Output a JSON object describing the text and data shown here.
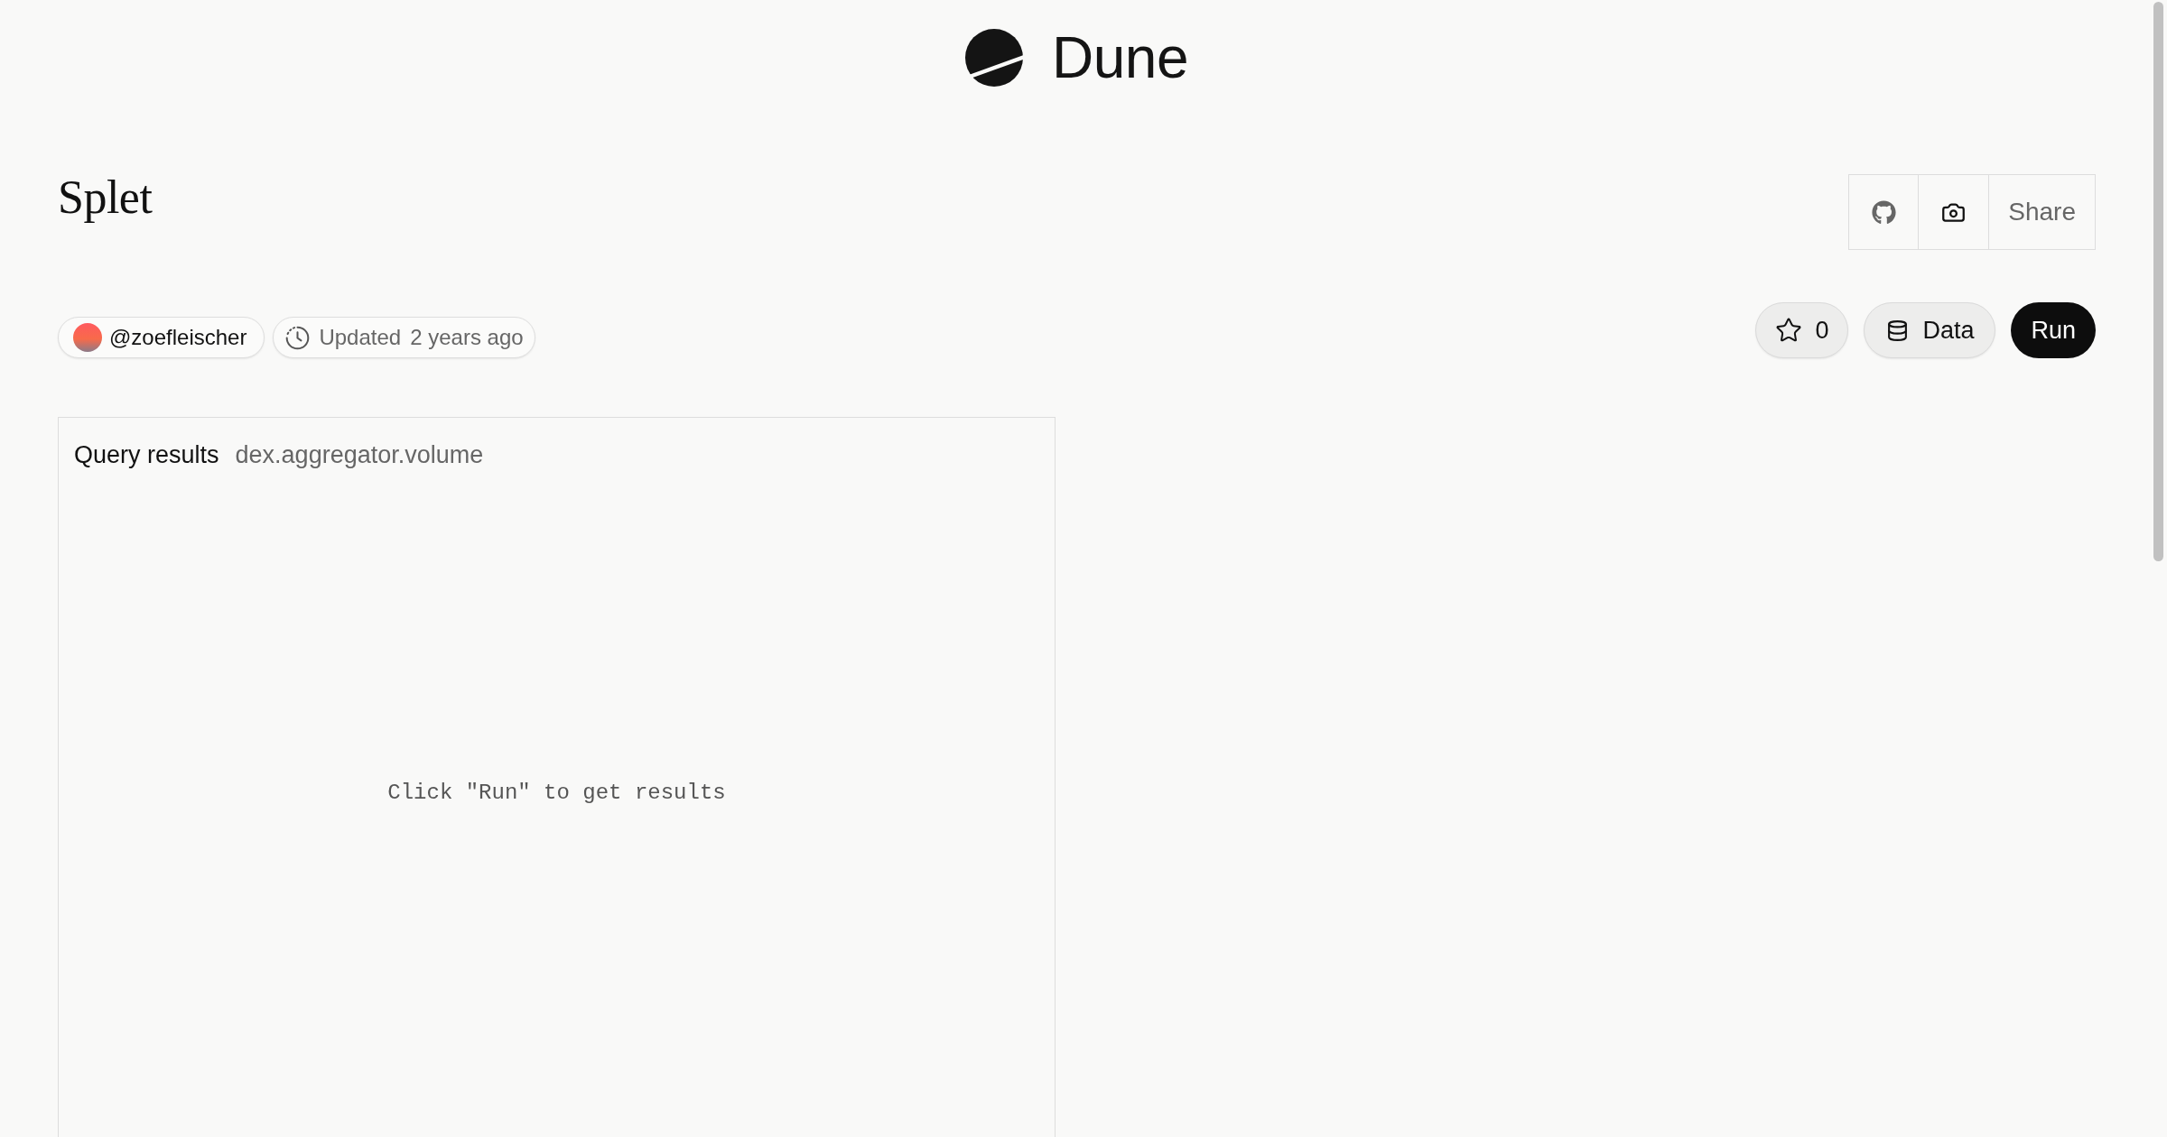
{
  "brand": {
    "name": "Dune"
  },
  "title": "Splet",
  "toolbar": {
    "share": "Share"
  },
  "meta": {
    "author": "@zoefleischer",
    "updated_label": "Updated",
    "updated_time": "2 years ago"
  },
  "actions": {
    "star_count": "0",
    "data": "Data",
    "run": "Run"
  },
  "query_results": {
    "title": "Query results",
    "table": "dex.aggregator.volume",
    "empty_message": "Click \"Run\" to get results"
  }
}
